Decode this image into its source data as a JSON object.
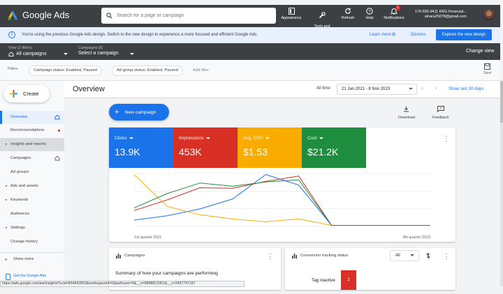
{
  "topbar": {
    "app_title": "Google Ads",
    "search_placeholder": "Search for a page or campaign",
    "tools": [
      {
        "label": "Appearance",
        "icon": "appearance-icon"
      },
      {
        "label": "Tools and\nsettings",
        "icon": "wrench-icon"
      },
      {
        "label": "Refresh",
        "icon": "refresh-icon"
      },
      {
        "label": "Help",
        "icon": "help-icon"
      },
      {
        "label": "Notifications",
        "icon": "bell-icon",
        "badge": "1"
      }
    ],
    "account_line1": "176-556-9411 KRG Financial...",
    "account_line2": "alnara25078@gmail.com"
  },
  "notice": {
    "message": "You're using the previous Google Ads design. Switch to the new design to experience a more focused and efficient Google Ads.",
    "learn_more": "Learn more",
    "dismiss": "Dismiss",
    "explore_button": "Explore the new design"
  },
  "selectors": {
    "view_label": "View (2 filters)",
    "view_value": "All campaigns",
    "campaigns_label": "Campaigns (5)",
    "campaigns_value": "Select a campaign",
    "change_view": "Change view"
  },
  "filters": {
    "label": "Filters",
    "chips": [
      "Campaign status: Enabled, Paused",
      "Ad group status: Enabled, Paused"
    ],
    "add_filter": "Add filter",
    "save_label": "Save"
  },
  "sidebar": {
    "create_label": "Create",
    "items": [
      {
        "label": "Overview",
        "state": "active"
      },
      {
        "label": "Recommendations",
        "state": "dot"
      },
      {
        "label": "Insights and reports",
        "state": "expandable"
      },
      {
        "label": "Campaigns",
        "state": "home"
      },
      {
        "label": "Ad groups",
        "state": ""
      },
      {
        "label": "Ads and assets",
        "state": "expandable"
      },
      {
        "label": "Keywords",
        "state": "expandable"
      },
      {
        "label": "Audiences",
        "state": ""
      },
      {
        "label": "Settings",
        "state": "expandable"
      },
      {
        "label": "Change history",
        "state": ""
      }
    ],
    "show_more": "Show more",
    "get_started": "Get the Google Ads"
  },
  "main": {
    "title": "Overview",
    "all_time": "All time",
    "date_range": "21 Jan 2021 - 8 Nov 2023",
    "show_last": "Show last 30 days",
    "new_campaign": "New campaign",
    "download": "Download",
    "feedback": "Feedback"
  },
  "colors": {
    "clicks": "#1a73e8",
    "impressions": "#d93025",
    "avg_cpc": "#f9ab00",
    "cost": "#1e8e3e",
    "primary": "#1a73e8"
  },
  "metrics": [
    {
      "label": "Clicks",
      "value": "13.9K",
      "color": "#1a73e8"
    },
    {
      "label": "Impressions",
      "value": "453K",
      "color": "#d93025"
    },
    {
      "label": "Avg. CPC",
      "value": "$1.53",
      "color": "#f9ab00"
    },
    {
      "label": "Cost",
      "value": "$21.2K",
      "color": "#1e8e3e"
    }
  ],
  "chart_data": {
    "type": "line",
    "x_start_label": "1st quarter 2021",
    "x_end_label": "4th quarter 2023",
    "grid": true,
    "series": [
      {
        "name": "Clicks",
        "color": "#1a73e8",
        "values": [
          0.12,
          0.2,
          0.33,
          0.52,
          0.98,
          0.78,
          0.02,
          0.02,
          0.02,
          0.02
        ]
      },
      {
        "name": "Impressions",
        "color": "#d93025",
        "values": [
          0.3,
          0.5,
          0.73,
          0.72,
          0.85,
          0.95,
          0.02,
          0.02,
          0.02,
          0.02
        ]
      },
      {
        "name": "Avg. CPC",
        "color": "#f9ab00",
        "values": [
          0.98,
          0.38,
          0.22,
          0.14,
          0.09,
          0.14,
          0.02,
          0.02,
          0.02,
          0.02
        ]
      },
      {
        "name": "Cost",
        "color": "#1e8e3e",
        "values": [
          0.35,
          0.62,
          0.82,
          0.76,
          0.84,
          0.88,
          0.02,
          0.02,
          0.02,
          0.02
        ]
      }
    ]
  },
  "campaigns_card": {
    "title": "Campaigns",
    "subtitle": "Summary of how your campaigns are performing"
  },
  "conversion_card": {
    "title": "Conversion tracking status",
    "filter_value": "All",
    "row_label": "Tag inactive",
    "row_value": "2"
  },
  "status_url": "https://ads.google.com/aw/insights?ocid=834842853&workspaceId=0&authuser=0&__u=8848813351&__c=2437747197"
}
